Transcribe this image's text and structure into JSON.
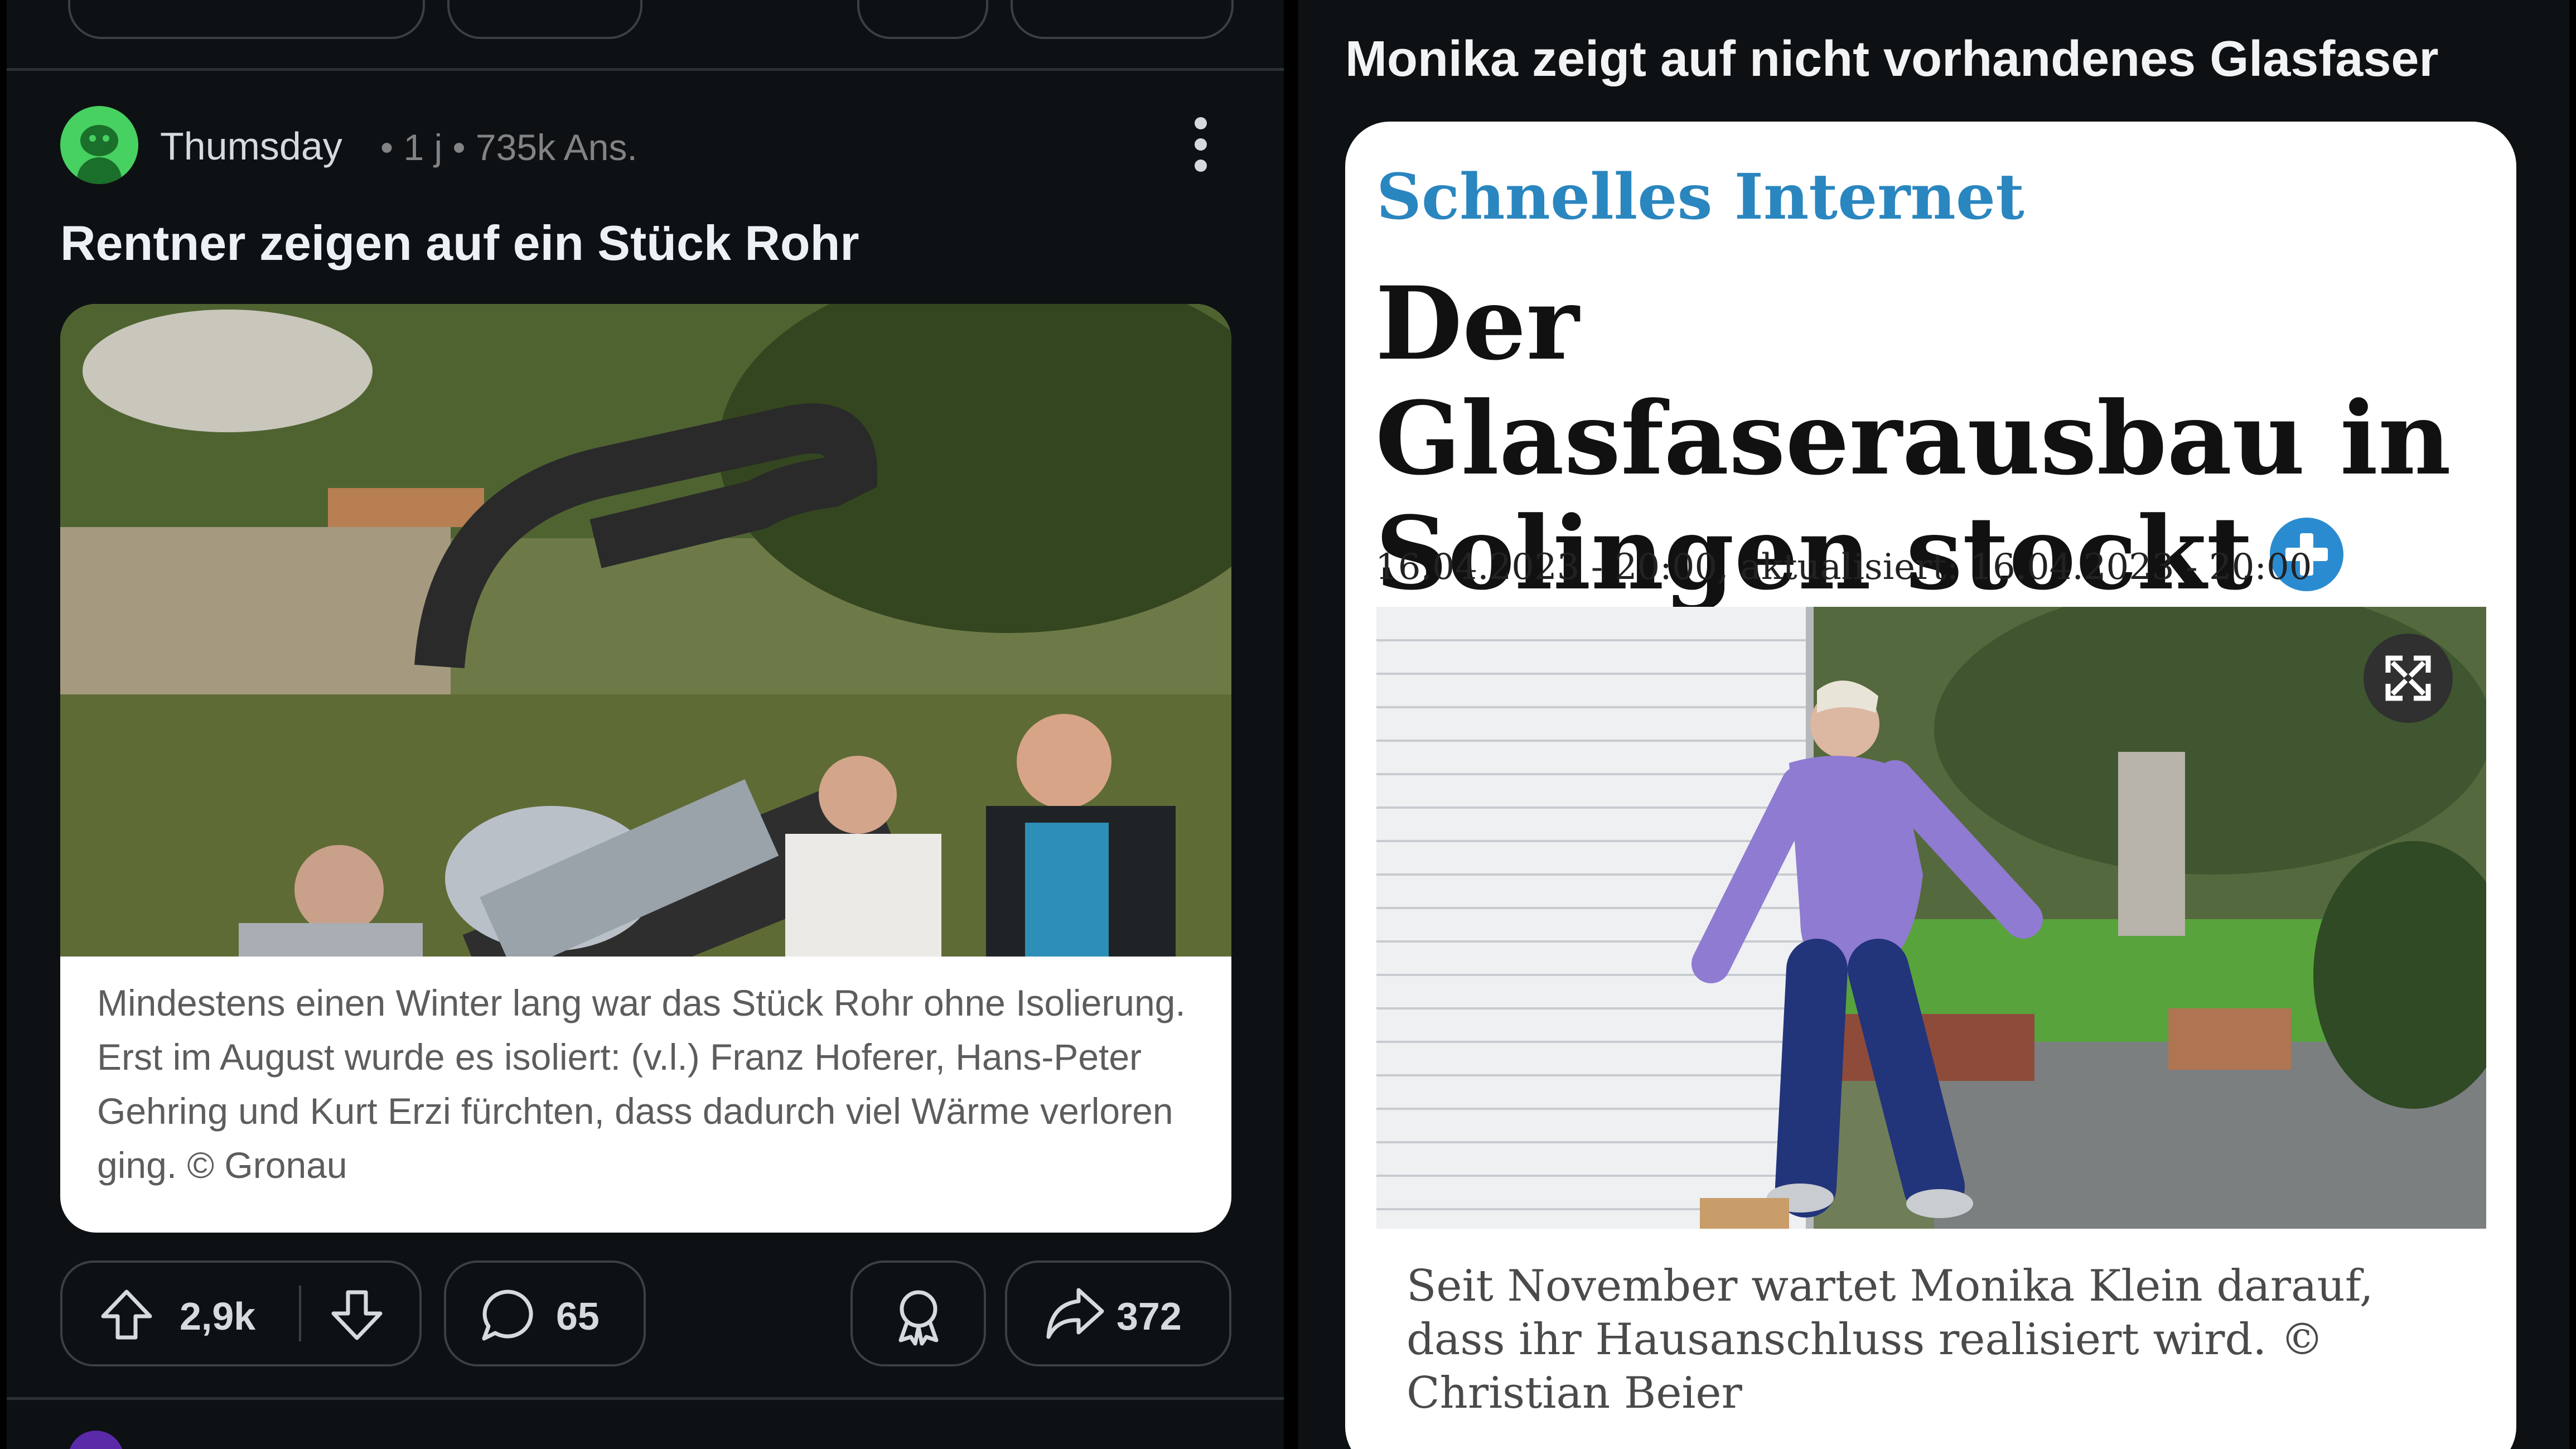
{
  "left_post": {
    "author": "Thumsday",
    "meta": "• 1 j • 735k Ans.",
    "title": "Rentner zeigen auf ein Stück Rohr",
    "image_caption": "Mindestens einen Winter lang war das Stück Rohr ohne Isolierung. Erst im August wurde es isoliert: (v.l.) Franz Hoferer, Hans-Peter Gehring und Kurt Erzi fürchten, dass dadurch viel Wärme verloren ging. © Gronau",
    "upvotes": "2,9k",
    "comments": "65",
    "shares": "372",
    "icons": [
      "upvote-icon",
      "downvote-icon",
      "comment-icon",
      "award-icon",
      "share-icon",
      "more-icon"
    ]
  },
  "right_post": {
    "title": "Monika zeigt auf nicht vorhandenes Glasfaser",
    "article": {
      "kicker": "Schnelles Internet",
      "headline": "Der Glasfaserausbau in Solingen stockt",
      "dateline": "16.04.2023 - 20:00, aktualisiert: 16.04.2023 - 20:00",
      "image_caption": "Seit November wartet Monika Klein darauf, dass ihr Hausanschluss realisiert wird.   © Christian Beier"
    }
  },
  "colors": {
    "background": "#0e1113",
    "text": "#d7dadc",
    "kicker_blue": "#2a86bf",
    "plus_blue": "#2b8bd0",
    "avatar_green": "#46d160"
  }
}
